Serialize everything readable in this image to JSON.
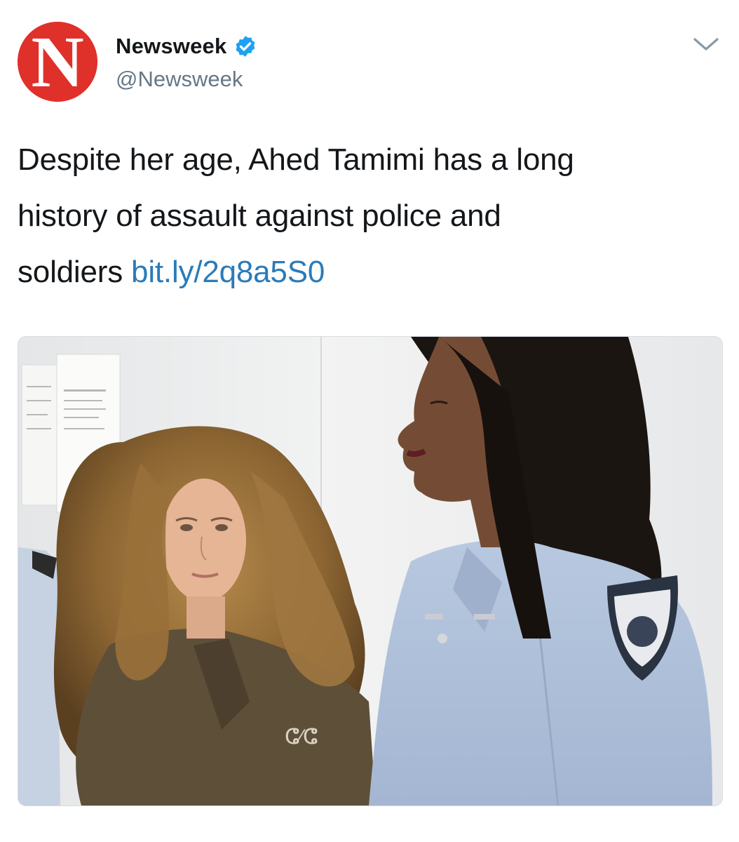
{
  "tweet": {
    "author": {
      "display_name": "Newsweek",
      "handle": "@Newsweek",
      "avatar_letter": "N",
      "verified": true,
      "avatar_color": "#e0302a"
    },
    "text": {
      "line1": "Despite her age, Ahed Tamimi has a long",
      "line2": "history of assault against police and",
      "line3": "soldiers",
      "link": "bit.ly/2q8a5S0"
    },
    "colors": {
      "link": "#2b7bb9",
      "verified": "#1da1f2",
      "text": "#14171a",
      "secondary": "#657786"
    },
    "icons": {
      "verified": "verified-badge-icon",
      "menu": "chevron-down-icon"
    }
  }
}
